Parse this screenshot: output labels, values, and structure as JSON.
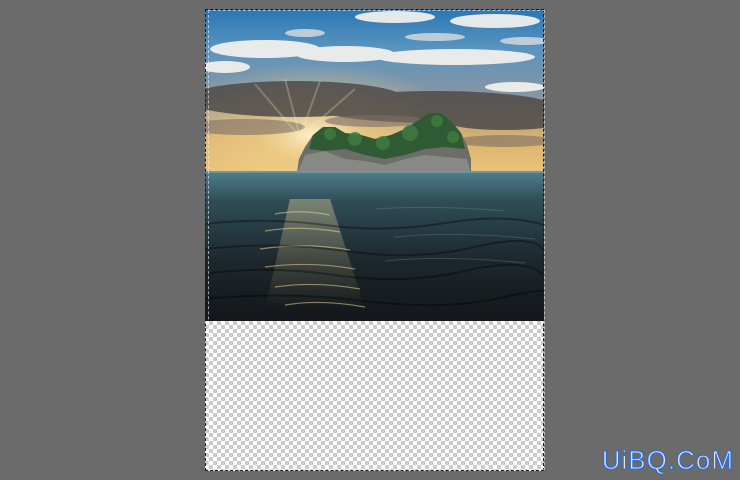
{
  "workspace": {
    "background_color": "#6b6b6b"
  },
  "document": {
    "transparency_grid": {
      "light": "#ffffff",
      "dark": "#cccccc"
    },
    "photo_layer": {
      "description_icon": "island-seascape-image",
      "sky_top_color": "#2f7db9",
      "horizon_color": "#e3b15c",
      "sea_color": "#2d3d44"
    },
    "selection": {
      "style": "marching-ants"
    }
  },
  "watermark": {
    "text": "UiBQ.CoM"
  }
}
